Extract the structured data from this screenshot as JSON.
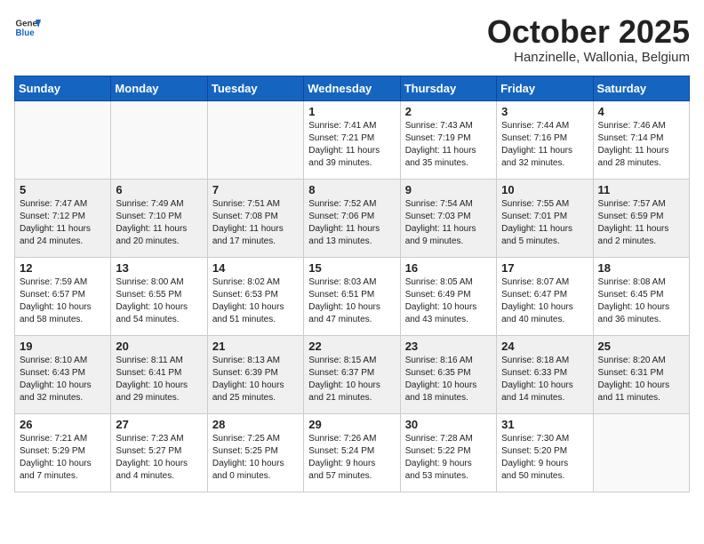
{
  "header": {
    "logo_general": "General",
    "logo_blue": "Blue",
    "month_title": "October 2025",
    "location": "Hanzinelle, Wallonia, Belgium"
  },
  "weekdays": [
    "Sunday",
    "Monday",
    "Tuesday",
    "Wednesday",
    "Thursday",
    "Friday",
    "Saturday"
  ],
  "weeks": [
    [
      {
        "day": "",
        "content": ""
      },
      {
        "day": "",
        "content": ""
      },
      {
        "day": "",
        "content": ""
      },
      {
        "day": "1",
        "content": "Sunrise: 7:41 AM\nSunset: 7:21 PM\nDaylight: 11 hours\nand 39 minutes."
      },
      {
        "day": "2",
        "content": "Sunrise: 7:43 AM\nSunset: 7:19 PM\nDaylight: 11 hours\nand 35 minutes."
      },
      {
        "day": "3",
        "content": "Sunrise: 7:44 AM\nSunset: 7:16 PM\nDaylight: 11 hours\nand 32 minutes."
      },
      {
        "day": "4",
        "content": "Sunrise: 7:46 AM\nSunset: 7:14 PM\nDaylight: 11 hours\nand 28 minutes."
      }
    ],
    [
      {
        "day": "5",
        "content": "Sunrise: 7:47 AM\nSunset: 7:12 PM\nDaylight: 11 hours\nand 24 minutes."
      },
      {
        "day": "6",
        "content": "Sunrise: 7:49 AM\nSunset: 7:10 PM\nDaylight: 11 hours\nand 20 minutes."
      },
      {
        "day": "7",
        "content": "Sunrise: 7:51 AM\nSunset: 7:08 PM\nDaylight: 11 hours\nand 17 minutes."
      },
      {
        "day": "8",
        "content": "Sunrise: 7:52 AM\nSunset: 7:06 PM\nDaylight: 11 hours\nand 13 minutes."
      },
      {
        "day": "9",
        "content": "Sunrise: 7:54 AM\nSunset: 7:03 PM\nDaylight: 11 hours\nand 9 minutes."
      },
      {
        "day": "10",
        "content": "Sunrise: 7:55 AM\nSunset: 7:01 PM\nDaylight: 11 hours\nand 5 minutes."
      },
      {
        "day": "11",
        "content": "Sunrise: 7:57 AM\nSunset: 6:59 PM\nDaylight: 11 hours\nand 2 minutes."
      }
    ],
    [
      {
        "day": "12",
        "content": "Sunrise: 7:59 AM\nSunset: 6:57 PM\nDaylight: 10 hours\nand 58 minutes."
      },
      {
        "day": "13",
        "content": "Sunrise: 8:00 AM\nSunset: 6:55 PM\nDaylight: 10 hours\nand 54 minutes."
      },
      {
        "day": "14",
        "content": "Sunrise: 8:02 AM\nSunset: 6:53 PM\nDaylight: 10 hours\nand 51 minutes."
      },
      {
        "day": "15",
        "content": "Sunrise: 8:03 AM\nSunset: 6:51 PM\nDaylight: 10 hours\nand 47 minutes."
      },
      {
        "day": "16",
        "content": "Sunrise: 8:05 AM\nSunset: 6:49 PM\nDaylight: 10 hours\nand 43 minutes."
      },
      {
        "day": "17",
        "content": "Sunrise: 8:07 AM\nSunset: 6:47 PM\nDaylight: 10 hours\nand 40 minutes."
      },
      {
        "day": "18",
        "content": "Sunrise: 8:08 AM\nSunset: 6:45 PM\nDaylight: 10 hours\nand 36 minutes."
      }
    ],
    [
      {
        "day": "19",
        "content": "Sunrise: 8:10 AM\nSunset: 6:43 PM\nDaylight: 10 hours\nand 32 minutes."
      },
      {
        "day": "20",
        "content": "Sunrise: 8:11 AM\nSunset: 6:41 PM\nDaylight: 10 hours\nand 29 minutes."
      },
      {
        "day": "21",
        "content": "Sunrise: 8:13 AM\nSunset: 6:39 PM\nDaylight: 10 hours\nand 25 minutes."
      },
      {
        "day": "22",
        "content": "Sunrise: 8:15 AM\nSunset: 6:37 PM\nDaylight: 10 hours\nand 21 minutes."
      },
      {
        "day": "23",
        "content": "Sunrise: 8:16 AM\nSunset: 6:35 PM\nDaylight: 10 hours\nand 18 minutes."
      },
      {
        "day": "24",
        "content": "Sunrise: 8:18 AM\nSunset: 6:33 PM\nDaylight: 10 hours\nand 14 minutes."
      },
      {
        "day": "25",
        "content": "Sunrise: 8:20 AM\nSunset: 6:31 PM\nDaylight: 10 hours\nand 11 minutes."
      }
    ],
    [
      {
        "day": "26",
        "content": "Sunrise: 7:21 AM\nSunset: 5:29 PM\nDaylight: 10 hours\nand 7 minutes."
      },
      {
        "day": "27",
        "content": "Sunrise: 7:23 AM\nSunset: 5:27 PM\nDaylight: 10 hours\nand 4 minutes."
      },
      {
        "day": "28",
        "content": "Sunrise: 7:25 AM\nSunset: 5:25 PM\nDaylight: 10 hours\nand 0 minutes."
      },
      {
        "day": "29",
        "content": "Sunrise: 7:26 AM\nSunset: 5:24 PM\nDaylight: 9 hours\nand 57 minutes."
      },
      {
        "day": "30",
        "content": "Sunrise: 7:28 AM\nSunset: 5:22 PM\nDaylight: 9 hours\nand 53 minutes."
      },
      {
        "day": "31",
        "content": "Sunrise: 7:30 AM\nSunset: 5:20 PM\nDaylight: 9 hours\nand 50 minutes."
      },
      {
        "day": "",
        "content": ""
      }
    ]
  ]
}
